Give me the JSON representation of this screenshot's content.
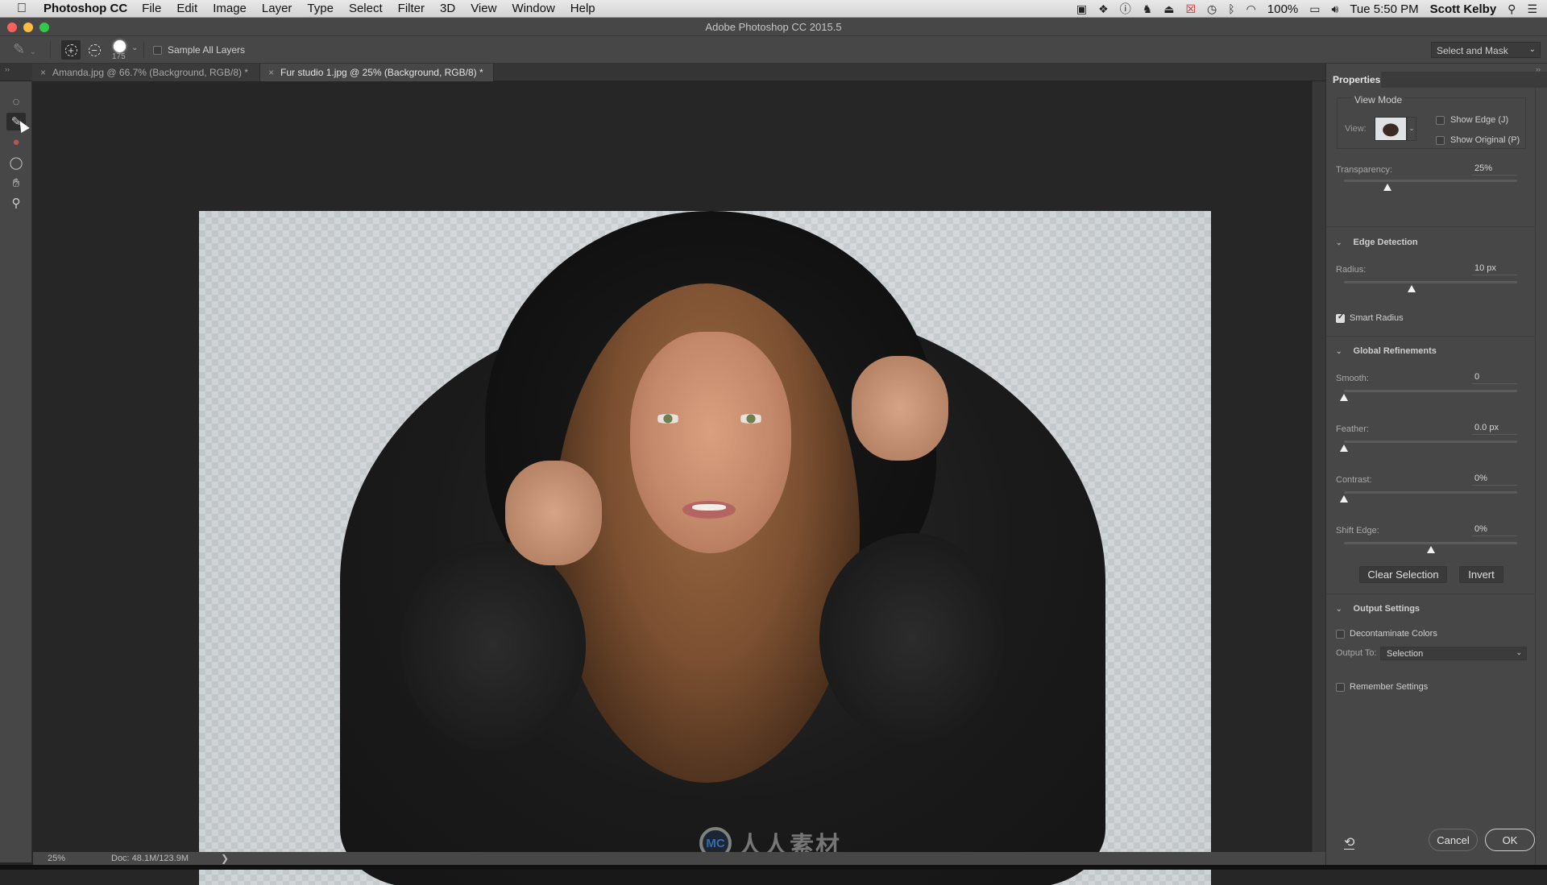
{
  "menubar": {
    "app_name": "Photoshop CC",
    "items": [
      "File",
      "Edit",
      "Image",
      "Layer",
      "Type",
      "Select",
      "Filter",
      "3D",
      "View",
      "Window",
      "Help"
    ],
    "status_icons": [
      "camera-icon",
      "dropbox-icon",
      "1password-icon",
      "evernote-icon",
      "airplay-icon",
      "display-mirroring-icon",
      "time-machine-icon",
      "bluetooth-icon",
      "wifi-icon"
    ],
    "battery": "100%",
    "clock": "Tue 5:50 PM",
    "user": "Scott Kelby"
  },
  "window": {
    "title": "Adobe Photoshop CC 2015.5"
  },
  "options_bar": {
    "brush_size": "175",
    "sample_all_layers_label": "Sample All Layers",
    "sample_all_layers_checked": false,
    "select_and_mask_label": "Select and Mask"
  },
  "tabs": [
    {
      "label": "Amanda.jpg @ 66.7% (Background, RGB/8) *",
      "active": false
    },
    {
      "label": "Fur studio 1.jpg @ 25% (Background, RGB/8) *",
      "active": true
    }
  ],
  "tools": [
    {
      "name": "quick-selection-tool",
      "glyph": "◌"
    },
    {
      "name": "refine-edge-brush-tool",
      "glyph": "✎",
      "active": true
    },
    {
      "name": "brush-tool",
      "glyph": "●"
    },
    {
      "name": "lasso-tool",
      "glyph": "ʘ"
    },
    {
      "name": "hand-tool",
      "glyph": "✋"
    },
    {
      "name": "zoom-tool",
      "glyph": "⚲"
    }
  ],
  "status_bar": {
    "zoom": "25%",
    "doc_info": "Doc: 48.1M/123.9M",
    "arrow": "❯"
  },
  "watermark": {
    "logo_text": "MC",
    "text": "人人素材"
  },
  "properties": {
    "tab_label": "Properties",
    "view_mode": {
      "title": "View Mode",
      "view_label": "View:",
      "show_edge_label": "Show Edge (J)",
      "show_edge_checked": false,
      "show_original_label": "Show Original (P)",
      "show_original_checked": false
    },
    "transparency": {
      "label": "Transparency:",
      "value": "25%",
      "fraction": 0.25
    },
    "edge_detection": {
      "title": "Edge Detection",
      "radius": {
        "label": "Radius:",
        "value": "10 px",
        "fraction": 0.39
      },
      "smart_radius_label": "Smart Radius",
      "smart_radius_checked": true
    },
    "global_refinements": {
      "title": "Global Refinements",
      "smooth": {
        "label": "Smooth:",
        "value": "0",
        "fraction": 0.0
      },
      "feather": {
        "label": "Feather:",
        "value": "0.0 px",
        "fraction": 0.0
      },
      "contrast": {
        "label": "Contrast:",
        "value": "0%",
        "fraction": 0.0
      },
      "shift_edge": {
        "label": "Shift Edge:",
        "value": "0%",
        "fraction": 0.5
      }
    },
    "clear_selection_label": "Clear Selection",
    "invert_label": "Invert",
    "output_settings": {
      "title": "Output Settings",
      "decontaminate_label": "Decontaminate Colors",
      "decontaminate_checked": false,
      "output_to_label": "Output To:",
      "output_to_value": "Selection"
    },
    "remember_settings_label": "Remember Settings",
    "remember_settings_checked": false,
    "cancel_label": "Cancel",
    "ok_label": "OK"
  },
  "colors": {
    "panel_bg": "#474747",
    "canvas_bg": "#262626",
    "close_red": "#fc605c",
    "minimize_yellow": "#fdbc40",
    "zoom_green": "#34c84a"
  }
}
